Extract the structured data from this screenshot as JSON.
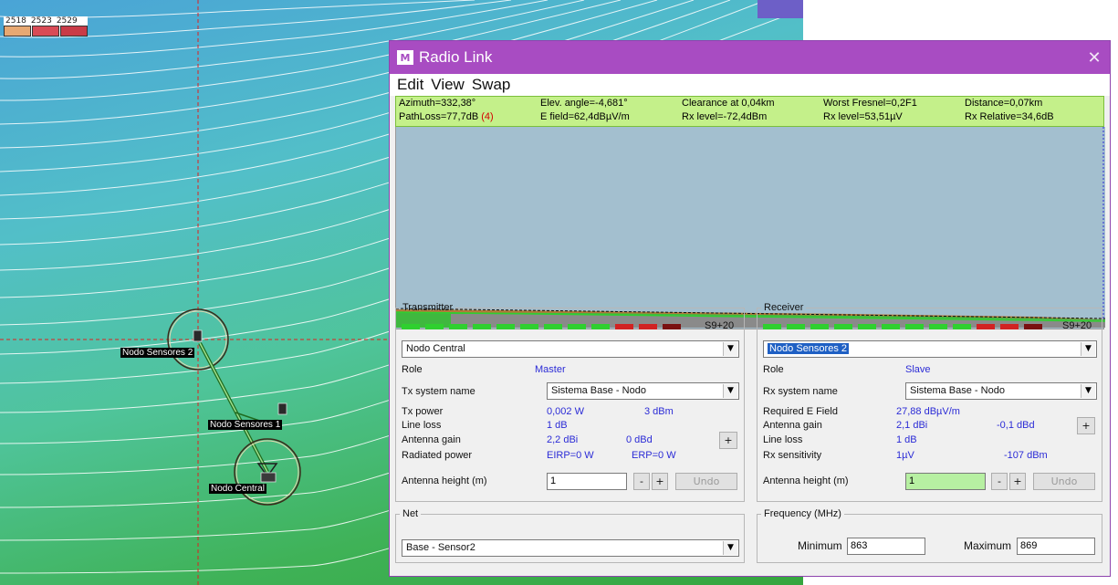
{
  "map": {
    "legend": {
      "labels": [
        "2518",
        "2523",
        "2529"
      ],
      "colors": [
        "#e7a872",
        "#d94b56",
        "#c93b48"
      ]
    },
    "nodes": {
      "sensores2": "Nodo Sensores 2",
      "sensores1": "Nodo Sensores 1",
      "central": "Nodo Central"
    },
    "colors": {
      "crosshair": "#e02020",
      "link": "#1f6b1f",
      "contour": "#ffffff"
    }
  },
  "window": {
    "title": "Radio Link",
    "menu": [
      "Edit",
      "View",
      "Swap"
    ],
    "info": {
      "row1": [
        "Azimuth=332,38°",
        "Elev. angle=-4,681°",
        "Clearance at 0,04km",
        "Worst Fresnel=0,2F1",
        "Distance=0,07km"
      ],
      "row2_pathloss": "PathLoss=77,7dB",
      "row2_pathloss_flag": "(4)",
      "row2": [
        "E field=62,4dBµV/m",
        "Rx level=-72,4dBm",
        "Rx level=53,51µV",
        "Rx Relative=34,6dB"
      ]
    }
  },
  "transmitter": {
    "title": "Transmitter",
    "meter_label": "S9+20",
    "unit": "Nodo Central",
    "role_label": "Role",
    "role": "Master",
    "system_label": "Tx system name",
    "system": "Sistema Base - Nodo",
    "tx_power_label": "Tx power",
    "tx_power_w": "0,002 W",
    "tx_power_dbm": "3 dBm",
    "line_loss_label": "Line loss",
    "line_loss": "1 dB",
    "antenna_gain_label": "Antenna gain",
    "antenna_gain_dbi": "2,2 dBi",
    "antenna_gain_dbd": "0 dBd",
    "radiated_label": "Radiated power",
    "eirp": "EIRP=0 W",
    "erp": "ERP=0 W",
    "height_label": "Antenna height (m)",
    "height": "1",
    "minus": "-",
    "plus": "+",
    "undo": "Undo"
  },
  "receiver": {
    "title": "Receiver",
    "meter_label": "S9+20",
    "unit": "Nodo Sensores 2",
    "role_label": "Role",
    "role": "Slave",
    "system_label": "Rx system name",
    "system": "Sistema Base - Nodo",
    "req_field_label": "Required E Field",
    "req_field": "27,88 dBµV/m",
    "antenna_gain_label": "Antenna gain",
    "antenna_gain_dbi": "2,1 dBi",
    "antenna_gain_dbd": "-0,1 dBd",
    "line_loss_label": "Line loss",
    "line_loss": "1 dB",
    "sensitivity_label": "Rx sensitivity",
    "sensitivity_uv": "1µV",
    "sensitivity_dbm": "-107 dBm",
    "height_label": "Antenna height (m)",
    "height": "1",
    "minus": "-",
    "plus": "+",
    "undo": "Undo"
  },
  "net": {
    "title": "Net",
    "value": "Base - Sensor2"
  },
  "frequency": {
    "title": "Frequency (MHz)",
    "min_label": "Minimum",
    "min": "863",
    "max_label": "Maximum",
    "max": "869"
  }
}
